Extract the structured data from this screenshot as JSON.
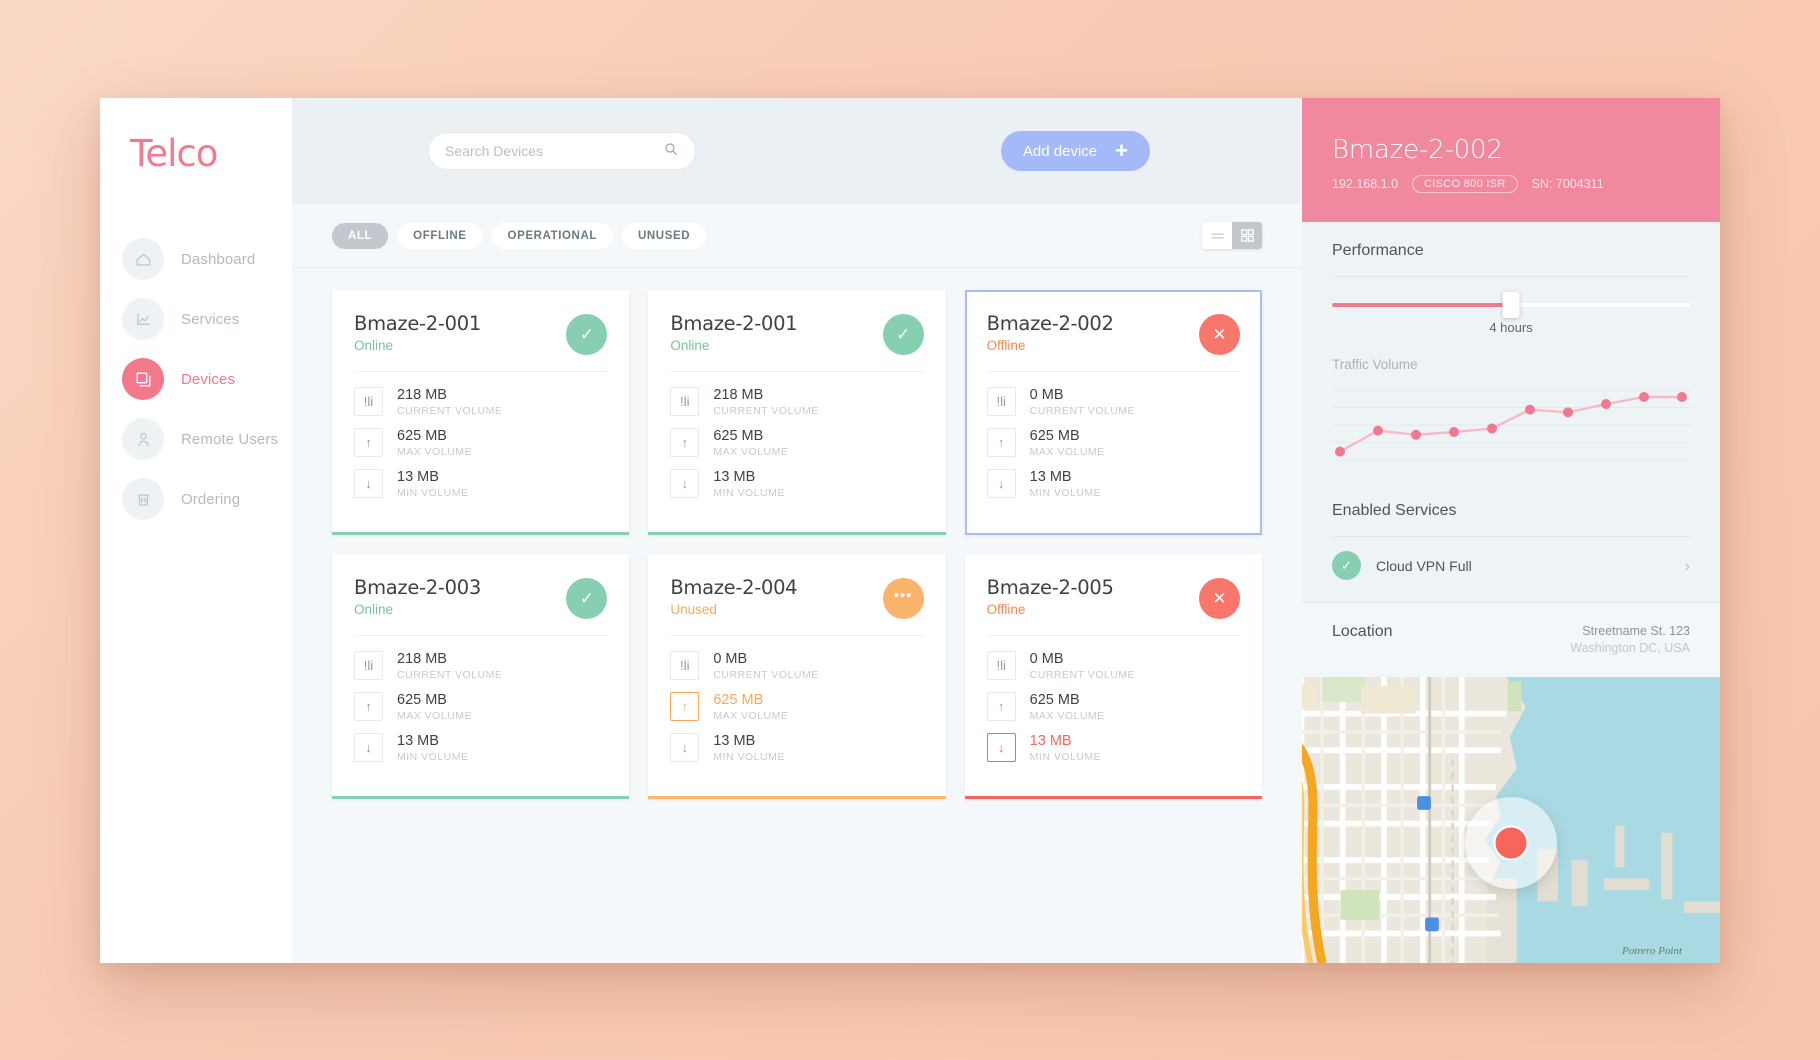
{
  "brand": {
    "name": "Telco"
  },
  "sidebar": {
    "items": [
      {
        "label": "Dashboard",
        "icon": "home-icon",
        "active": false
      },
      {
        "label": "Services",
        "icon": "chart-icon",
        "active": false
      },
      {
        "label": "Devices",
        "icon": "devices-icon",
        "active": true
      },
      {
        "label": "Remote Users",
        "icon": "user-icon",
        "active": false
      },
      {
        "label": "Ordering",
        "icon": "cart-icon",
        "active": false
      }
    ]
  },
  "toolbar": {
    "search_placeholder": "Search Devices",
    "search_value": "",
    "search_icon": "search-icon",
    "add_device_label": "Add device",
    "add_device_icon": "plus-icon",
    "add_device_color": "#a5b8f7"
  },
  "filters": {
    "chips": [
      {
        "label": "ALL",
        "active": true
      },
      {
        "label": "OFFLINE",
        "active": false
      },
      {
        "label": "OPERATIONAL",
        "active": false
      },
      {
        "label": "UNUSED",
        "active": false
      }
    ],
    "views": [
      {
        "name": "list-view",
        "active": false
      },
      {
        "name": "grid-view",
        "active": true
      }
    ]
  },
  "labels": {
    "current_volume": "CURRENT VOLUME",
    "max_volume": "MAX VOLUME",
    "min_volume": "MIN VOLUME"
  },
  "devices": [
    {
      "name": "Bmaze-2-001",
      "status": "Online",
      "status_color": "#7ac29a",
      "badge": "ok",
      "badge_glyph": "✓",
      "accent": "#86cfb0",
      "selected": false,
      "current": "218 MB",
      "max": "625 MB",
      "min": "13 MB",
      "current_hl": "",
      "max_hl": "",
      "min_hl": ""
    },
    {
      "name": "Bmaze-2-001",
      "status": "Online",
      "status_color": "#7ac29a",
      "badge": "ok",
      "badge_glyph": "✓",
      "accent": "#86cfb0",
      "selected": false,
      "current": "218 MB",
      "max": "625 MB",
      "min": "13 MB",
      "current_hl": "",
      "max_hl": "",
      "min_hl": ""
    },
    {
      "name": "Bmaze-2-002",
      "status": "Offline",
      "status_color": "#f5864f",
      "badge": "err",
      "badge_glyph": "✕",
      "accent": "#a9bdf2",
      "selected": true,
      "current": "0 MB",
      "max": "625 MB",
      "min": "13 MB",
      "current_hl": "",
      "max_hl": "",
      "min_hl": ""
    },
    {
      "name": "Bmaze-2-003",
      "status": "Online",
      "status_color": "#7ac29a",
      "badge": "ok",
      "badge_glyph": "✓",
      "accent": "#86cfb0",
      "selected": false,
      "current": "218 MB",
      "max": "625 MB",
      "min": "13 MB",
      "current_hl": "",
      "max_hl": "",
      "min_hl": ""
    },
    {
      "name": "Bmaze-2-004",
      "status": "Unused",
      "status_color": "#f5a95b",
      "badge": "warn",
      "badge_glyph": "•••",
      "accent": "#f9b86b",
      "selected": false,
      "current": "0 MB",
      "max": "625 MB",
      "min": "13 MB",
      "current_hl": "",
      "max_hl": "orange",
      "min_hl": ""
    },
    {
      "name": "Bmaze-2-005",
      "status": "Offline",
      "status_color": "#f5864f",
      "badge": "err",
      "badge_glyph": "✕",
      "accent": "#f8655c",
      "selected": false,
      "current": "0 MB",
      "max": "625 MB",
      "min": "13 MB",
      "current_hl": "",
      "max_hl": "",
      "min_hl": "red"
    }
  ],
  "detail": {
    "title": "Bmaze-2-002",
    "ip": "192.168.1.0",
    "model": "CISCO 800 ISR",
    "serial": "SN: 7004311",
    "header_color": "#f0899f",
    "performance_title": "Performance",
    "slider_value": "4 hours",
    "slider_percent": 50,
    "chart_title": "Traffic Volume",
    "services_title": "Enabled Services",
    "services": [
      {
        "name": "Cloud VPN Full",
        "enabled": true,
        "badge_glyph": "✓",
        "chevron": "›"
      }
    ],
    "location_title": "Location",
    "address_line1": "Streetname St. 123",
    "address_line2": "Washington DC, USA",
    "map_label": "Potrero Point"
  },
  "chart_data": {
    "type": "line",
    "title": "Traffic Volume",
    "x": [
      1,
      2,
      3,
      4,
      5,
      6,
      7,
      8,
      9,
      10
    ],
    "values": [
      12,
      42,
      36,
      40,
      45,
      72,
      68,
      80,
      90,
      90
    ],
    "ylim": [
      0,
      100
    ],
    "xlabel": "",
    "ylabel": "",
    "grid": true,
    "gridlines": 5,
    "legend": "none",
    "point_color": "#f0798f",
    "line_color": "#f7b9c6"
  }
}
